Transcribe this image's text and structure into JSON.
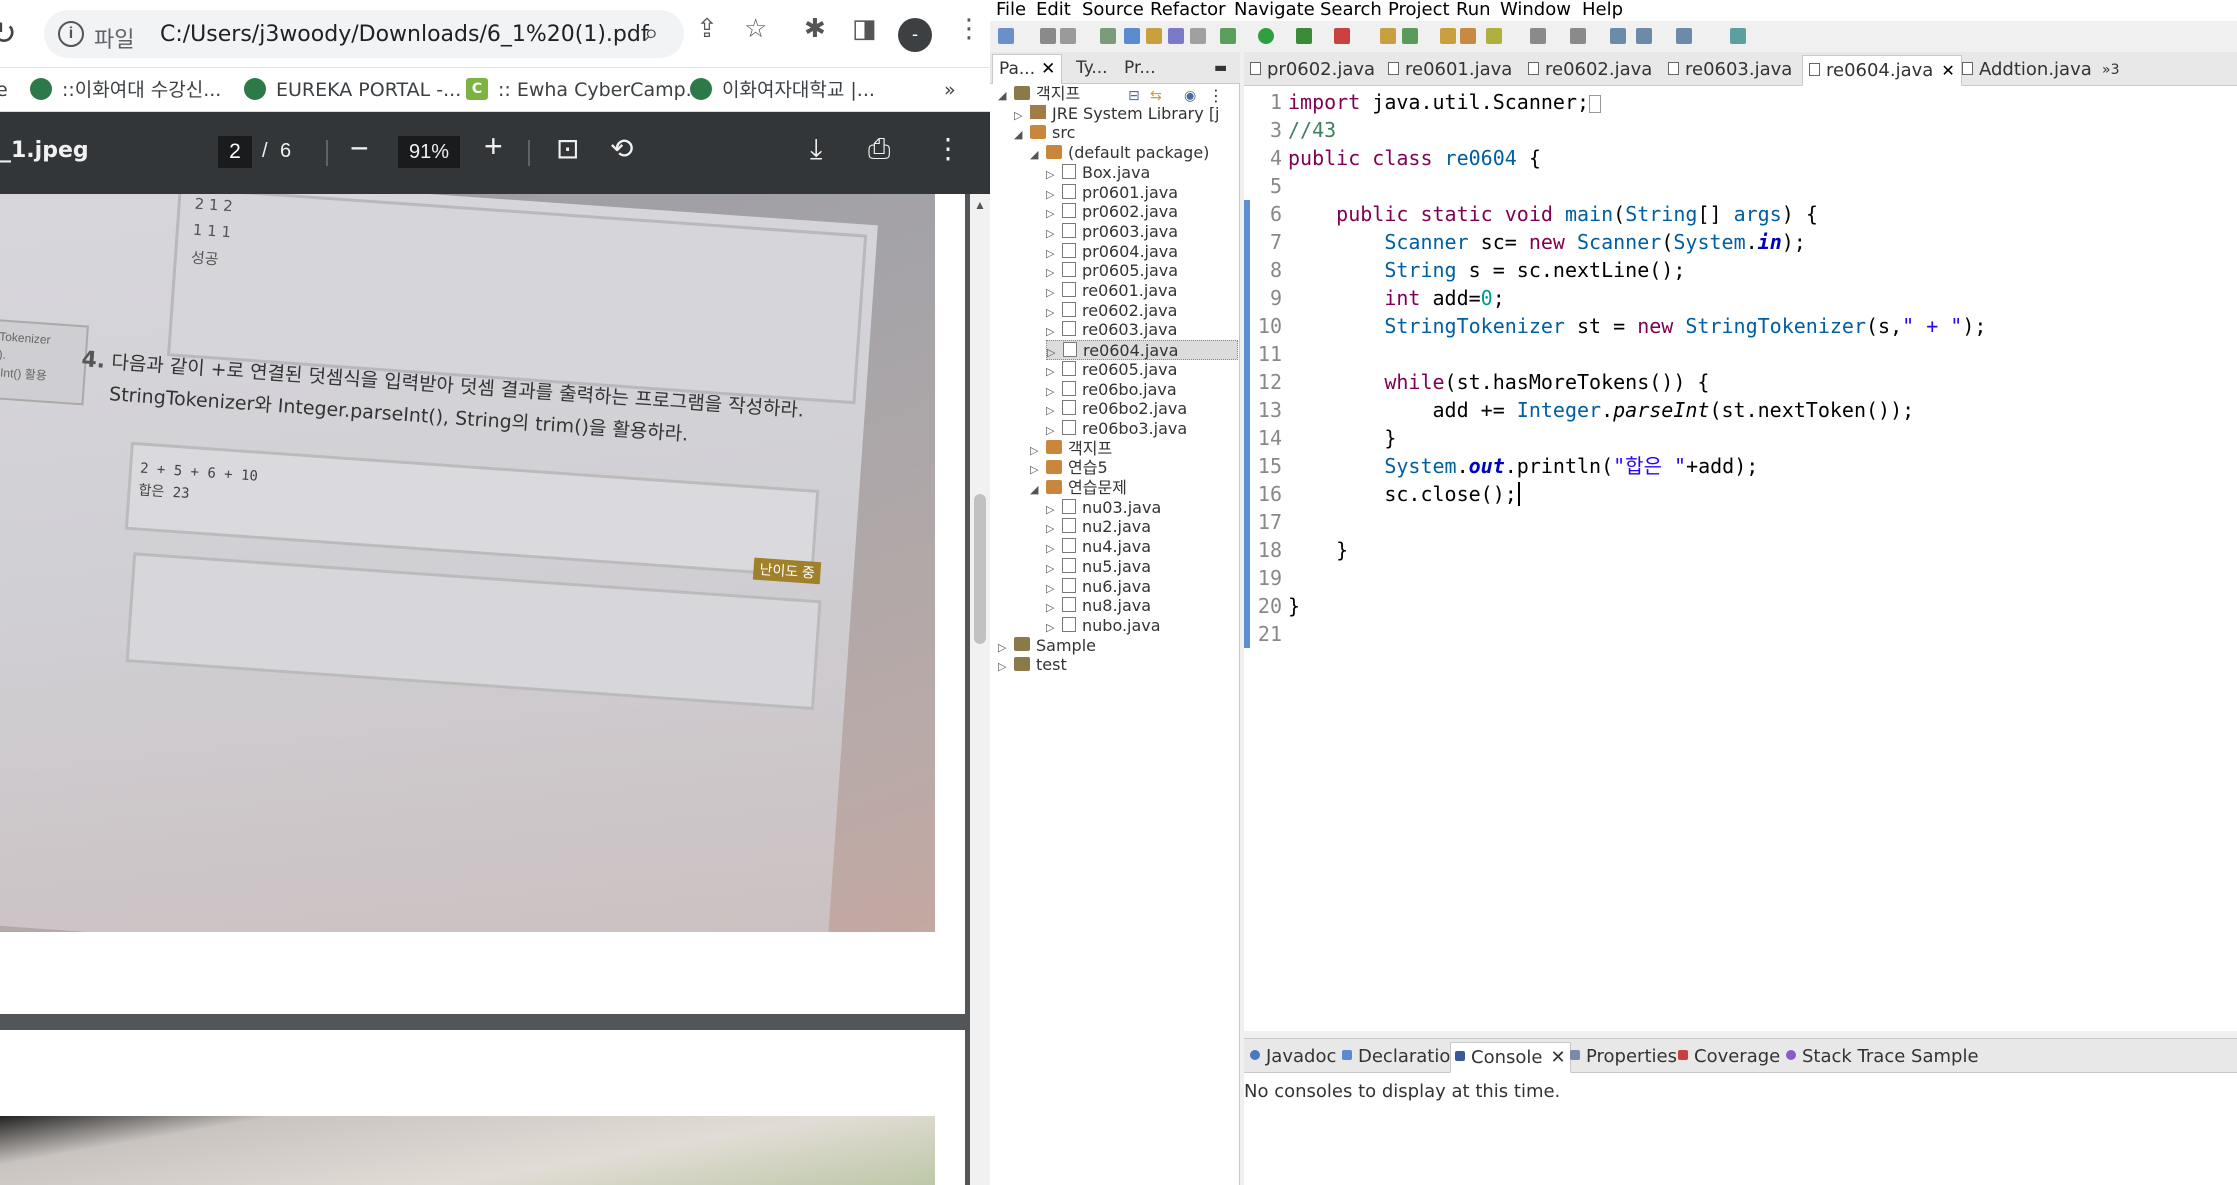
{
  "chrome": {
    "address": {
      "scheme_label": "파일",
      "url": "C:/Users/j3woody/Downloads/6_1%20(1).pdf"
    },
    "avatar_label": "-",
    "bookmarks": [
      "::이화여대 수강신...",
      "EUREKA PORTAL -...",
      ":: Ewha CyberCamp...",
      "이화여자대학교 |..."
    ],
    "more_bookmarks": "»",
    "pdf": {
      "file_name": "_1.jpeg",
      "current_page": "2",
      "page_sep": "/",
      "total_pages": "6",
      "zoom": "91%"
    }
  },
  "photo_text": {
    "table_rows": [
      "2   1   2",
      "1   1   1",
      "성공"
    ],
    "side_note": "ngTokenizer\nm().\nrseInt() 활용",
    "q_number": "4.",
    "question": "다음과 같이 +로 연결된 덧셈식을 입력받아 덧셈 결과를 출력하는 프로그램을 작성하라. StringTokenizer와 Integer.parseInt(), String의 trim()을 활용하라.",
    "example": "2 + 5 + 6 + 10\n합은 23",
    "difficulty": "난이도 중"
  },
  "eclipse": {
    "menu": [
      "File",
      "Edit",
      "Source",
      "Refactor",
      "Navigate",
      "Search",
      "Project",
      "Run",
      "Window",
      "Help"
    ],
    "left_tabs": [
      {
        "label": "Pa...",
        "active": true
      },
      {
        "label": "Ty...",
        "active": false
      },
      {
        "label": "Pr...",
        "active": false
      }
    ],
    "tree": [
      {
        "label": "객지프",
        "depth": 0,
        "kind": "project",
        "expanded": true
      },
      {
        "label": "JRE System Library [j",
        "depth": 1,
        "kind": "library",
        "expanded": false
      },
      {
        "label": "src",
        "depth": 1,
        "kind": "package",
        "expanded": true
      },
      {
        "label": "(default package)",
        "depth": 2,
        "kind": "package",
        "expanded": true
      },
      {
        "label": "Box.java",
        "depth": 3,
        "kind": "file"
      },
      {
        "label": "pr0601.java",
        "depth": 3,
        "kind": "file"
      },
      {
        "label": "pr0602.java",
        "depth": 3,
        "kind": "file"
      },
      {
        "label": "pr0603.java",
        "depth": 3,
        "kind": "file"
      },
      {
        "label": "pr0604.java",
        "depth": 3,
        "kind": "file"
      },
      {
        "label": "pr0605.java",
        "depth": 3,
        "kind": "file"
      },
      {
        "label": "re0601.java",
        "depth": 3,
        "kind": "file"
      },
      {
        "label": "re0602.java",
        "depth": 3,
        "kind": "file"
      },
      {
        "label": "re0603.java",
        "depth": 3,
        "kind": "file"
      },
      {
        "label": "re0604.java",
        "depth": 3,
        "kind": "file",
        "selected": true
      },
      {
        "label": "re0605.java",
        "depth": 3,
        "kind": "file"
      },
      {
        "label": "re06bo.java",
        "depth": 3,
        "kind": "file"
      },
      {
        "label": "re06bo2.java",
        "depth": 3,
        "kind": "file"
      },
      {
        "label": "re06bo3.java",
        "depth": 3,
        "kind": "file"
      },
      {
        "label": "객지프",
        "depth": 2,
        "kind": "package",
        "expanded": false
      },
      {
        "label": "연습5",
        "depth": 2,
        "kind": "package",
        "expanded": false
      },
      {
        "label": "연습문제",
        "depth": 2,
        "kind": "package",
        "expanded": true
      },
      {
        "label": "nu03.java",
        "depth": 3,
        "kind": "file"
      },
      {
        "label": "nu2.java",
        "depth": 3,
        "kind": "file"
      },
      {
        "label": "nu4.java",
        "depth": 3,
        "kind": "file"
      },
      {
        "label": "nu5.java",
        "depth": 3,
        "kind": "file"
      },
      {
        "label": "nu6.java",
        "depth": 3,
        "kind": "file"
      },
      {
        "label": "nu8.java",
        "depth": 3,
        "kind": "file"
      },
      {
        "label": "nubo.java",
        "depth": 3,
        "kind": "file"
      },
      {
        "label": "Sample",
        "depth": 0,
        "kind": "project",
        "expanded": false
      },
      {
        "label": "test",
        "depth": 0,
        "kind": "project",
        "expanded": false
      }
    ],
    "editor_tabs": [
      {
        "label": "pr0602.java",
        "active": false
      },
      {
        "label": "re0601.java",
        "active": false
      },
      {
        "label": "re0602.java",
        "active": false
      },
      {
        "label": "re0603.java",
        "active": false
      },
      {
        "label": "re0604.java",
        "active": true
      },
      {
        "label": "Addtion.java",
        "active": false
      }
    ],
    "editor_overflow": "»3",
    "code_lines": [
      "1",
      "3",
      "4",
      "5",
      "6",
      "7",
      "8",
      "9",
      "10",
      "11",
      "12",
      "13",
      "14",
      "15",
      "16",
      "17",
      "18",
      "19",
      "20",
      "21"
    ],
    "bottom_tabs": [
      {
        "label": "Javadoc",
        "active": false
      },
      {
        "label": "Declaration",
        "active": false
      },
      {
        "label": "Console",
        "active": true
      },
      {
        "label": "Properties",
        "active": false
      },
      {
        "label": "Coverage",
        "active": false
      },
      {
        "label": "Stack Trace Sample",
        "active": false
      }
    ],
    "console_message": "No consoles to display at this time."
  }
}
